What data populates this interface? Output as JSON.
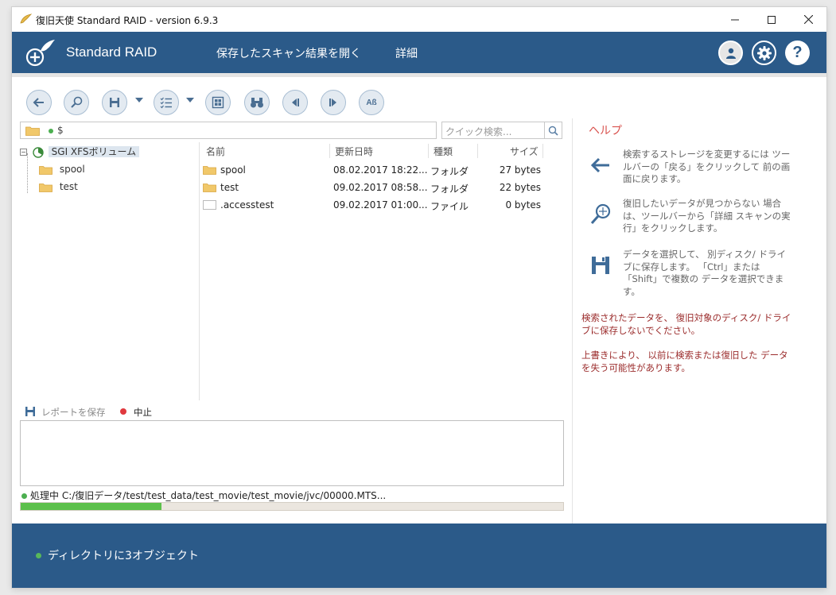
{
  "window": {
    "title": "復旧天使 Standard RAID - version 6.9.3"
  },
  "header": {
    "brand": "Standard RAID",
    "menu": [
      "保存したスキャン結果を開く",
      "詳細"
    ]
  },
  "path": {
    "text": "$"
  },
  "search": {
    "placeholder": "クイック検索..."
  },
  "tree": {
    "root": "SGI XFSボリューム",
    "children": [
      "spool",
      "test"
    ]
  },
  "file_list": {
    "columns": [
      "名前",
      "更新日時",
      "種類",
      "サイズ"
    ],
    "rows": [
      {
        "name": "spool",
        "date": "08.02.2017 18:22...",
        "type": "フォルダ",
        "size": "27 bytes",
        "icon": "folder-icon"
      },
      {
        "name": "test",
        "date": "09.02.2017 08:58...",
        "type": "フォルダ",
        "size": "22 bytes",
        "icon": "folder-icon"
      },
      {
        "name": ".accesstest",
        "date": "09.02.2017 01:00...",
        "type": "ファイル",
        "size": "0 bytes",
        "icon": "file-icon"
      }
    ]
  },
  "help": {
    "title": "ヘルプ",
    "items": [
      {
        "icon": "back-arrow-icon",
        "text": "検索するストレージを変更するには ツールバーの「戻る」をクリックして 前の画面に戻ります。"
      },
      {
        "icon": "magnifier-icon",
        "text": "復旧したいデータが見つからない 場合は、ツールバーから「詳細 スキャンの実行」をクリックします。"
      },
      {
        "icon": "save-disk-icon",
        "text": "データを選択して、 別ディスク/ ドライブに保存します。 「Ctrl」または「Shift」で複数の データを選択できます。"
      }
    ],
    "warning1": "検索されたデータを、 復旧対象のディスク/ ドライブに保存しないでください。",
    "warning2": "上書きにより、 以前に検索または復旧した データを失う可能性があります。"
  },
  "log": {
    "save_label": "レポートを保存",
    "stop_label": "中止"
  },
  "processing": {
    "text": "処理中 C:/復旧データ/test/test_data/test_movie/test_movie/jvc/00000.MTS...",
    "progress": 0.26
  },
  "status": {
    "text": "ディレクトリに3オブジェクト"
  },
  "colors": {
    "header_bg": "#2b5a89",
    "accent_red": "#d9534f",
    "progress_green": "#5cc04b"
  }
}
